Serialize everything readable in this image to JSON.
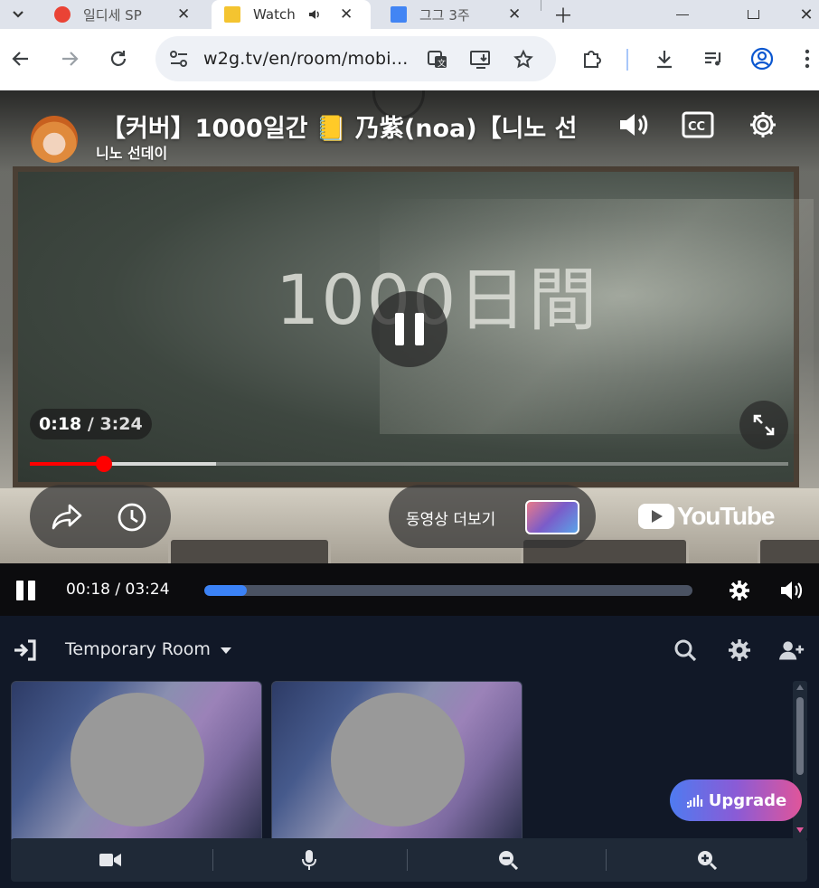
{
  "browser": {
    "tabs": [
      {
        "label": "일디세 SP",
        "favicon_color": "#ea4335"
      },
      {
        "label": "Watch",
        "favicon_color": "#f4c430",
        "active": true
      },
      {
        "label": "그그 3주",
        "favicon_color": "#4285f4"
      }
    ],
    "url": "w2g.tv/en/room/mobi..."
  },
  "video": {
    "title": "【커버】1000일간 📒 乃紫(noa)【니노 선",
    "channel": "니노 선데이",
    "chalkboard_text": "1000日間",
    "current_time": "0:18",
    "duration": "3:24",
    "progress_fraction": 0.098,
    "buffer_fraction": 0.245,
    "more_videos_label": "동영상 더보기",
    "provider": "YouTube"
  },
  "player_bar": {
    "time_display": "00:18 / 03:24",
    "progress_fraction": 0.087
  },
  "room": {
    "title": "Temporary Room",
    "upgrade_label": "Upgrade"
  },
  "colors": {
    "yt_red": "#ff0000",
    "w2g_accent": "#3b82f6",
    "room_bg": "#111827"
  }
}
